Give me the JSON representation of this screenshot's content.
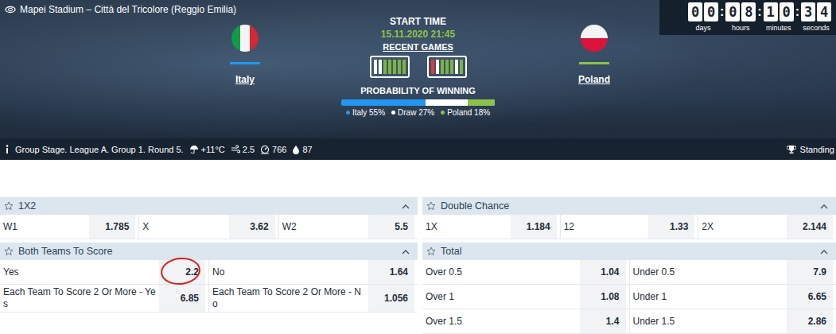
{
  "venue": "Mapei Stadium – Città del Tricolore (Reggio Emilia)",
  "start": {
    "label": "START TIME",
    "time": "15.11.2020 21:45"
  },
  "recent_games": {
    "label": "RECENT GAMES",
    "home": [
      {
        "color": "#ffffff"
      },
      {
        "color": "#ffffff"
      },
      {
        "color": "#7cb342"
      },
      {
        "color": "#7cb342"
      },
      {
        "color": "#7cb342"
      },
      {
        "color": "#7cb342"
      },
      {
        "color": "#7cb342"
      }
    ],
    "away": [
      {
        "color": "#e53935"
      },
      {
        "color": "#ffffff"
      },
      {
        "color": "#7cb342"
      },
      {
        "color": "#7cb342"
      },
      {
        "color": "#7cb342"
      },
      {
        "color": "#ffffff"
      },
      {
        "color": "#7cb342"
      }
    ]
  },
  "home": {
    "name": "Italy",
    "color": "#2196f3"
  },
  "away": {
    "name": "Poland",
    "color": "#8bc34a"
  },
  "probability": {
    "label": "PROBABILITY OF WINNING",
    "items": [
      {
        "label": "Italy 55%",
        "level": 0.55,
        "color": "#2196f3"
      },
      {
        "label": "Draw 27%",
        "level": 0.27,
        "color": "#ffffff"
      },
      {
        "label": "Poland 18%",
        "level": 0.18,
        "color": "#8bc34a"
      }
    ]
  },
  "countdown": {
    "separator": ":",
    "units": [
      {
        "digits": [
          "0",
          "0"
        ],
        "unit": "days"
      },
      {
        "digits": [
          "0",
          "8"
        ],
        "unit": "hours"
      },
      {
        "digits": [
          "1",
          "0"
        ],
        "unit": "minutes"
      },
      {
        "digits": [
          "3",
          "4"
        ],
        "unit": "seconds"
      }
    ]
  },
  "info": {
    "round": "Group Stage. League A. Group 1. Round 5.",
    "stats": [
      {
        "kind": "weather",
        "value": "+11°C"
      },
      {
        "kind": "wind",
        "value": "2.5"
      },
      {
        "kind": "pressure",
        "value": "766"
      },
      {
        "kind": "humidity",
        "value": "87"
      }
    ],
    "standings": "Standing"
  },
  "markets": {
    "left": [
      {
        "title": "1X2",
        "expanded": true,
        "rows": [
          [
            {
              "label": "W1",
              "odds": "1.785",
              "circled": false
            },
            {
              "label": "X",
              "odds": "3.62",
              "circled": false
            },
            {
              "label": "W2",
              "odds": "5.5",
              "circled": false
            }
          ]
        ]
      },
      {
        "title": "Both Teams To Score",
        "expanded": true,
        "rows": [
          [
            {
              "label": "Yes",
              "odds": "2.2",
              "circled": true
            },
            {
              "label": "No",
              "odds": "1.64",
              "circled": false
            }
          ],
          [
            {
              "label": "Each Team To Score 2 Or More - Yes",
              "odds": "6.85",
              "circled": false
            },
            {
              "label": "Each Team To Score 2 Or More - No",
              "odds": "1.056",
              "circled": false
            }
          ]
        ]
      }
    ],
    "right": [
      {
        "title": "Double Chance",
        "expanded": true,
        "rows": [
          [
            {
              "label": "1X",
              "odds": "1.184",
              "circled": false
            },
            {
              "label": "12",
              "odds": "1.33",
              "circled": false
            },
            {
              "label": "2X",
              "odds": "2.144",
              "circled": false
            }
          ]
        ]
      },
      {
        "title": "Total",
        "expanded": true,
        "rows": [
          [
            {
              "label": "Over 0.5",
              "odds": "1.04",
              "circled": false
            },
            {
              "label": "Under 0.5",
              "odds": "7.9",
              "circled": false
            }
          ],
          [
            {
              "label": "Over 1",
              "odds": "1.08",
              "circled": false
            },
            {
              "label": "Under 1",
              "odds": "6.65",
              "circled": false
            }
          ],
          [
            {
              "label": "Over 1.5",
              "odds": "1.4",
              "circled": false
            },
            {
              "label": "Under 1.5",
              "odds": "2.86",
              "circled": false
            }
          ]
        ]
      }
    ]
  }
}
